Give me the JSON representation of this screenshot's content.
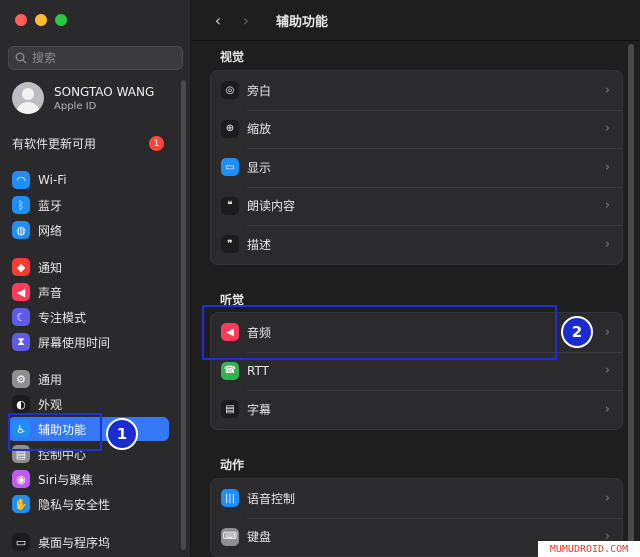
{
  "window": {
    "title": "辅助功能"
  },
  "colors": {
    "accent": "#3478f6",
    "annotation": "#1e2fd8",
    "badge": "#ff453a"
  },
  "sidebar": {
    "search_placeholder": "搜索",
    "account": {
      "name": "SONGTAO WANG",
      "subtitle": "Apple ID"
    },
    "update": {
      "label": "有软件更新可用",
      "count": "1"
    },
    "items": [
      {
        "label": "Wi-Fi",
        "icon": "wifi-icon",
        "glyph": "◠",
        "color": "#1f8ef5"
      },
      {
        "label": "蓝牙",
        "icon": "bluetooth-icon",
        "glyph": "ᛒ",
        "color": "#1f8ef5"
      },
      {
        "label": "网络",
        "icon": "globe-icon",
        "glyph": "◍",
        "color": "#1f8ef5"
      },
      {
        "label": "通知",
        "icon": "bell-icon",
        "glyph": "◆",
        "color": "#ff3b30"
      },
      {
        "label": "声音",
        "icon": "speaker-icon",
        "glyph": "◀",
        "color": "#ff3b5c"
      },
      {
        "label": "专注模式",
        "icon": "moon-icon",
        "glyph": "☾",
        "color": "#5e5ce6"
      },
      {
        "label": "屏幕使用时间",
        "icon": "hourglass-icon",
        "glyph": "⧗",
        "color": "#5e5ce6"
      },
      {
        "label": "通用",
        "icon": "gear-icon",
        "glyph": "⚙",
        "color": "#8e8e93"
      },
      {
        "label": "外观",
        "icon": "appearance-icon",
        "glyph": "◐",
        "color": "#1c1c1e"
      },
      {
        "label": "辅助功能",
        "icon": "accessibility-icon",
        "glyph": "♿",
        "color": "#1f8ef5",
        "selected": true
      },
      {
        "label": "控制中心",
        "icon": "control-center-icon",
        "glyph": "▤",
        "color": "#8e8e93"
      },
      {
        "label": "Siri与聚焦",
        "icon": "siri-icon",
        "glyph": "◉",
        "color": "#bf5af2"
      },
      {
        "label": "隐私与安全性",
        "icon": "hand-icon",
        "glyph": "✋",
        "color": "#1f8ef5"
      },
      {
        "label": "桌面与程序坞",
        "icon": "dock-icon",
        "glyph": "▭",
        "color": "#1c1c1e"
      }
    ]
  },
  "main": {
    "sections": [
      {
        "title": "视觉",
        "rows": [
          {
            "label": "旁白",
            "icon": "voiceover-icon",
            "glyph": "◎",
            "color": "#1c1c1e"
          },
          {
            "label": "缩放",
            "icon": "zoom-icon",
            "glyph": "⊕",
            "color": "#1c1c1e"
          },
          {
            "label": "显示",
            "icon": "display-icon",
            "glyph": "▭",
            "color": "#1f8ef5"
          },
          {
            "label": "朗读内容",
            "icon": "spoken-content-icon",
            "glyph": "❝",
            "color": "#1c1c1e"
          },
          {
            "label": "描述",
            "icon": "descriptions-icon",
            "glyph": "❞",
            "color": "#1c1c1e"
          }
        ]
      },
      {
        "title": "听觉",
        "rows": [
          {
            "label": "音频",
            "icon": "audio-icon",
            "glyph": "◀",
            "color": "#ff3b5c"
          },
          {
            "label": "RTT",
            "icon": "rtt-icon",
            "glyph": "☎",
            "color": "#30b350"
          },
          {
            "label": "字幕",
            "icon": "captions-icon",
            "glyph": "▤",
            "color": "#1c1c1e"
          }
        ]
      },
      {
        "title": "动作",
        "rows": [
          {
            "label": "语音控制",
            "icon": "voice-control-icon",
            "glyph": "|||",
            "color": "#1f8ef5"
          },
          {
            "label": "键盘",
            "icon": "keyboard-icon",
            "glyph": "⌨",
            "color": "#8e8e93"
          }
        ]
      }
    ]
  },
  "annotations": [
    {
      "label": "1"
    },
    {
      "label": "2"
    }
  ],
  "watermark": "MUMUDROID.COM"
}
